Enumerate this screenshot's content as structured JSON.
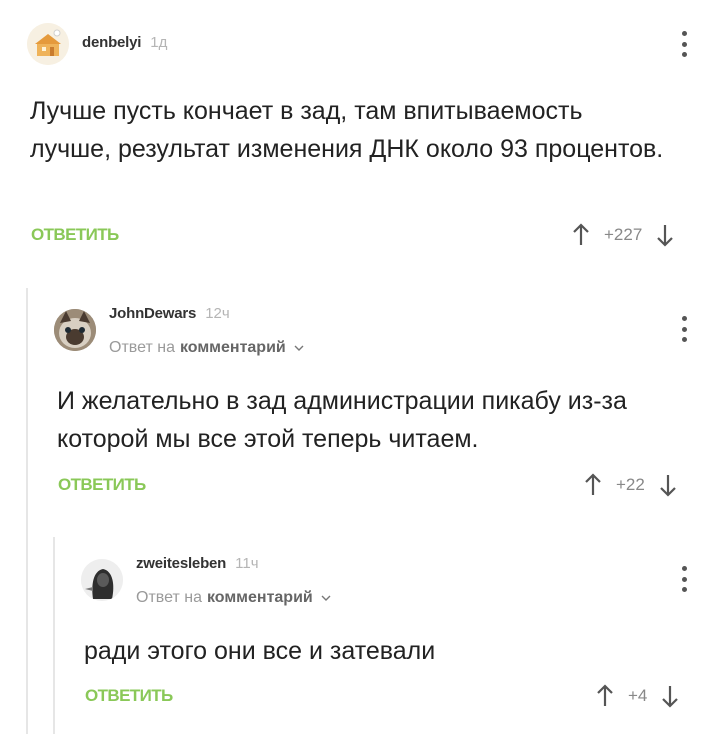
{
  "comments": [
    {
      "author": "denbelyi",
      "time": "1д",
      "text": "Лучше пусть кончает в зад, там впитываемость лучше, результат изменения ДНК около 93 процентов.",
      "reply_label": "ОТВЕТИТЬ",
      "rating": "+227"
    },
    {
      "author": "JohnDewars",
      "time": "12ч",
      "reply_to_prefix": "Ответ на",
      "reply_to_link": "комментарий",
      "text": "И желательно в зад администрации пикабу из-за которой мы все этой теперь читаем.",
      "reply_label": "ОТВЕТИТЬ",
      "rating": "+22"
    },
    {
      "author": "zweitesleben",
      "time": "11ч",
      "reply_to_prefix": "Ответ на",
      "reply_to_link": "комментарий",
      "text": "ради этого они все и затевали",
      "reply_label": "ОТВЕТИТЬ",
      "rating": "+4"
    }
  ],
  "colors": {
    "accent": "#8ac858",
    "thread_line": "#e6e6e6"
  },
  "icons": [
    "chevron-down-icon",
    "more-vertical-icon",
    "arrow-up-icon",
    "arrow-down-icon"
  ]
}
